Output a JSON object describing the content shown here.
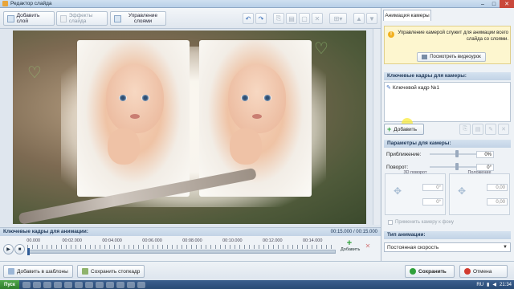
{
  "window": {
    "title": "Редактор слайда"
  },
  "toolbar": {
    "add_layer": "Добавить слой",
    "effects": "Эффекты слайда",
    "layers_line1": "Управление",
    "layers_line2": "слоями"
  },
  "panel": {
    "tab": "Анимация камеры",
    "info_text": "Управление камерой служит для анимации всего слайда со слоями.",
    "video_button": "Посмотреть видеоурок",
    "keyframes_header": "Ключевые кадры для камеры:",
    "keyframe_item": "Ключевой кадр №1",
    "add_button": "Добавить",
    "params_header": "Параметры для камеры:",
    "zoom_label": "Приближение:",
    "zoom_value": "0%",
    "rotate_label": "Поворот:",
    "rotate_value": "0°",
    "rotate3d_caption": "3D поворот",
    "position_caption": "Положение",
    "rot3d_x": "0°",
    "rot3d_y": "0°",
    "pos_x": "0,00",
    "pos_y": "0,00",
    "apply_checkbox": "Применить камеру к фону",
    "anim_type_header": "Тип анимации:",
    "anim_type_value": "Постоянная скорость"
  },
  "timeline": {
    "header": "Ключевые кадры для анимации:",
    "time": "00:15.000 / 00:15.000",
    "ticks": [
      "00.000",
      "00:02.000",
      "00:04.000",
      "00:06.000",
      "00:08.000",
      "00:10.000",
      "00:12.000",
      "00:14.000"
    ],
    "add_label": "Добавить"
  },
  "bottom": {
    "add_templates": "Добавить в шаблоны",
    "save_stopframe": "Сохранить стопкадр",
    "save": "Сохранить",
    "cancel": "Отмена"
  },
  "taskbar": {
    "start": "Пуск",
    "lang": "RU",
    "clock": "21:34"
  },
  "colors": {
    "accent": "#2f5c96",
    "header_bg": "#c2d3e6",
    "save_icon": "#2fa03a",
    "cancel_icon": "#d23b2f"
  }
}
